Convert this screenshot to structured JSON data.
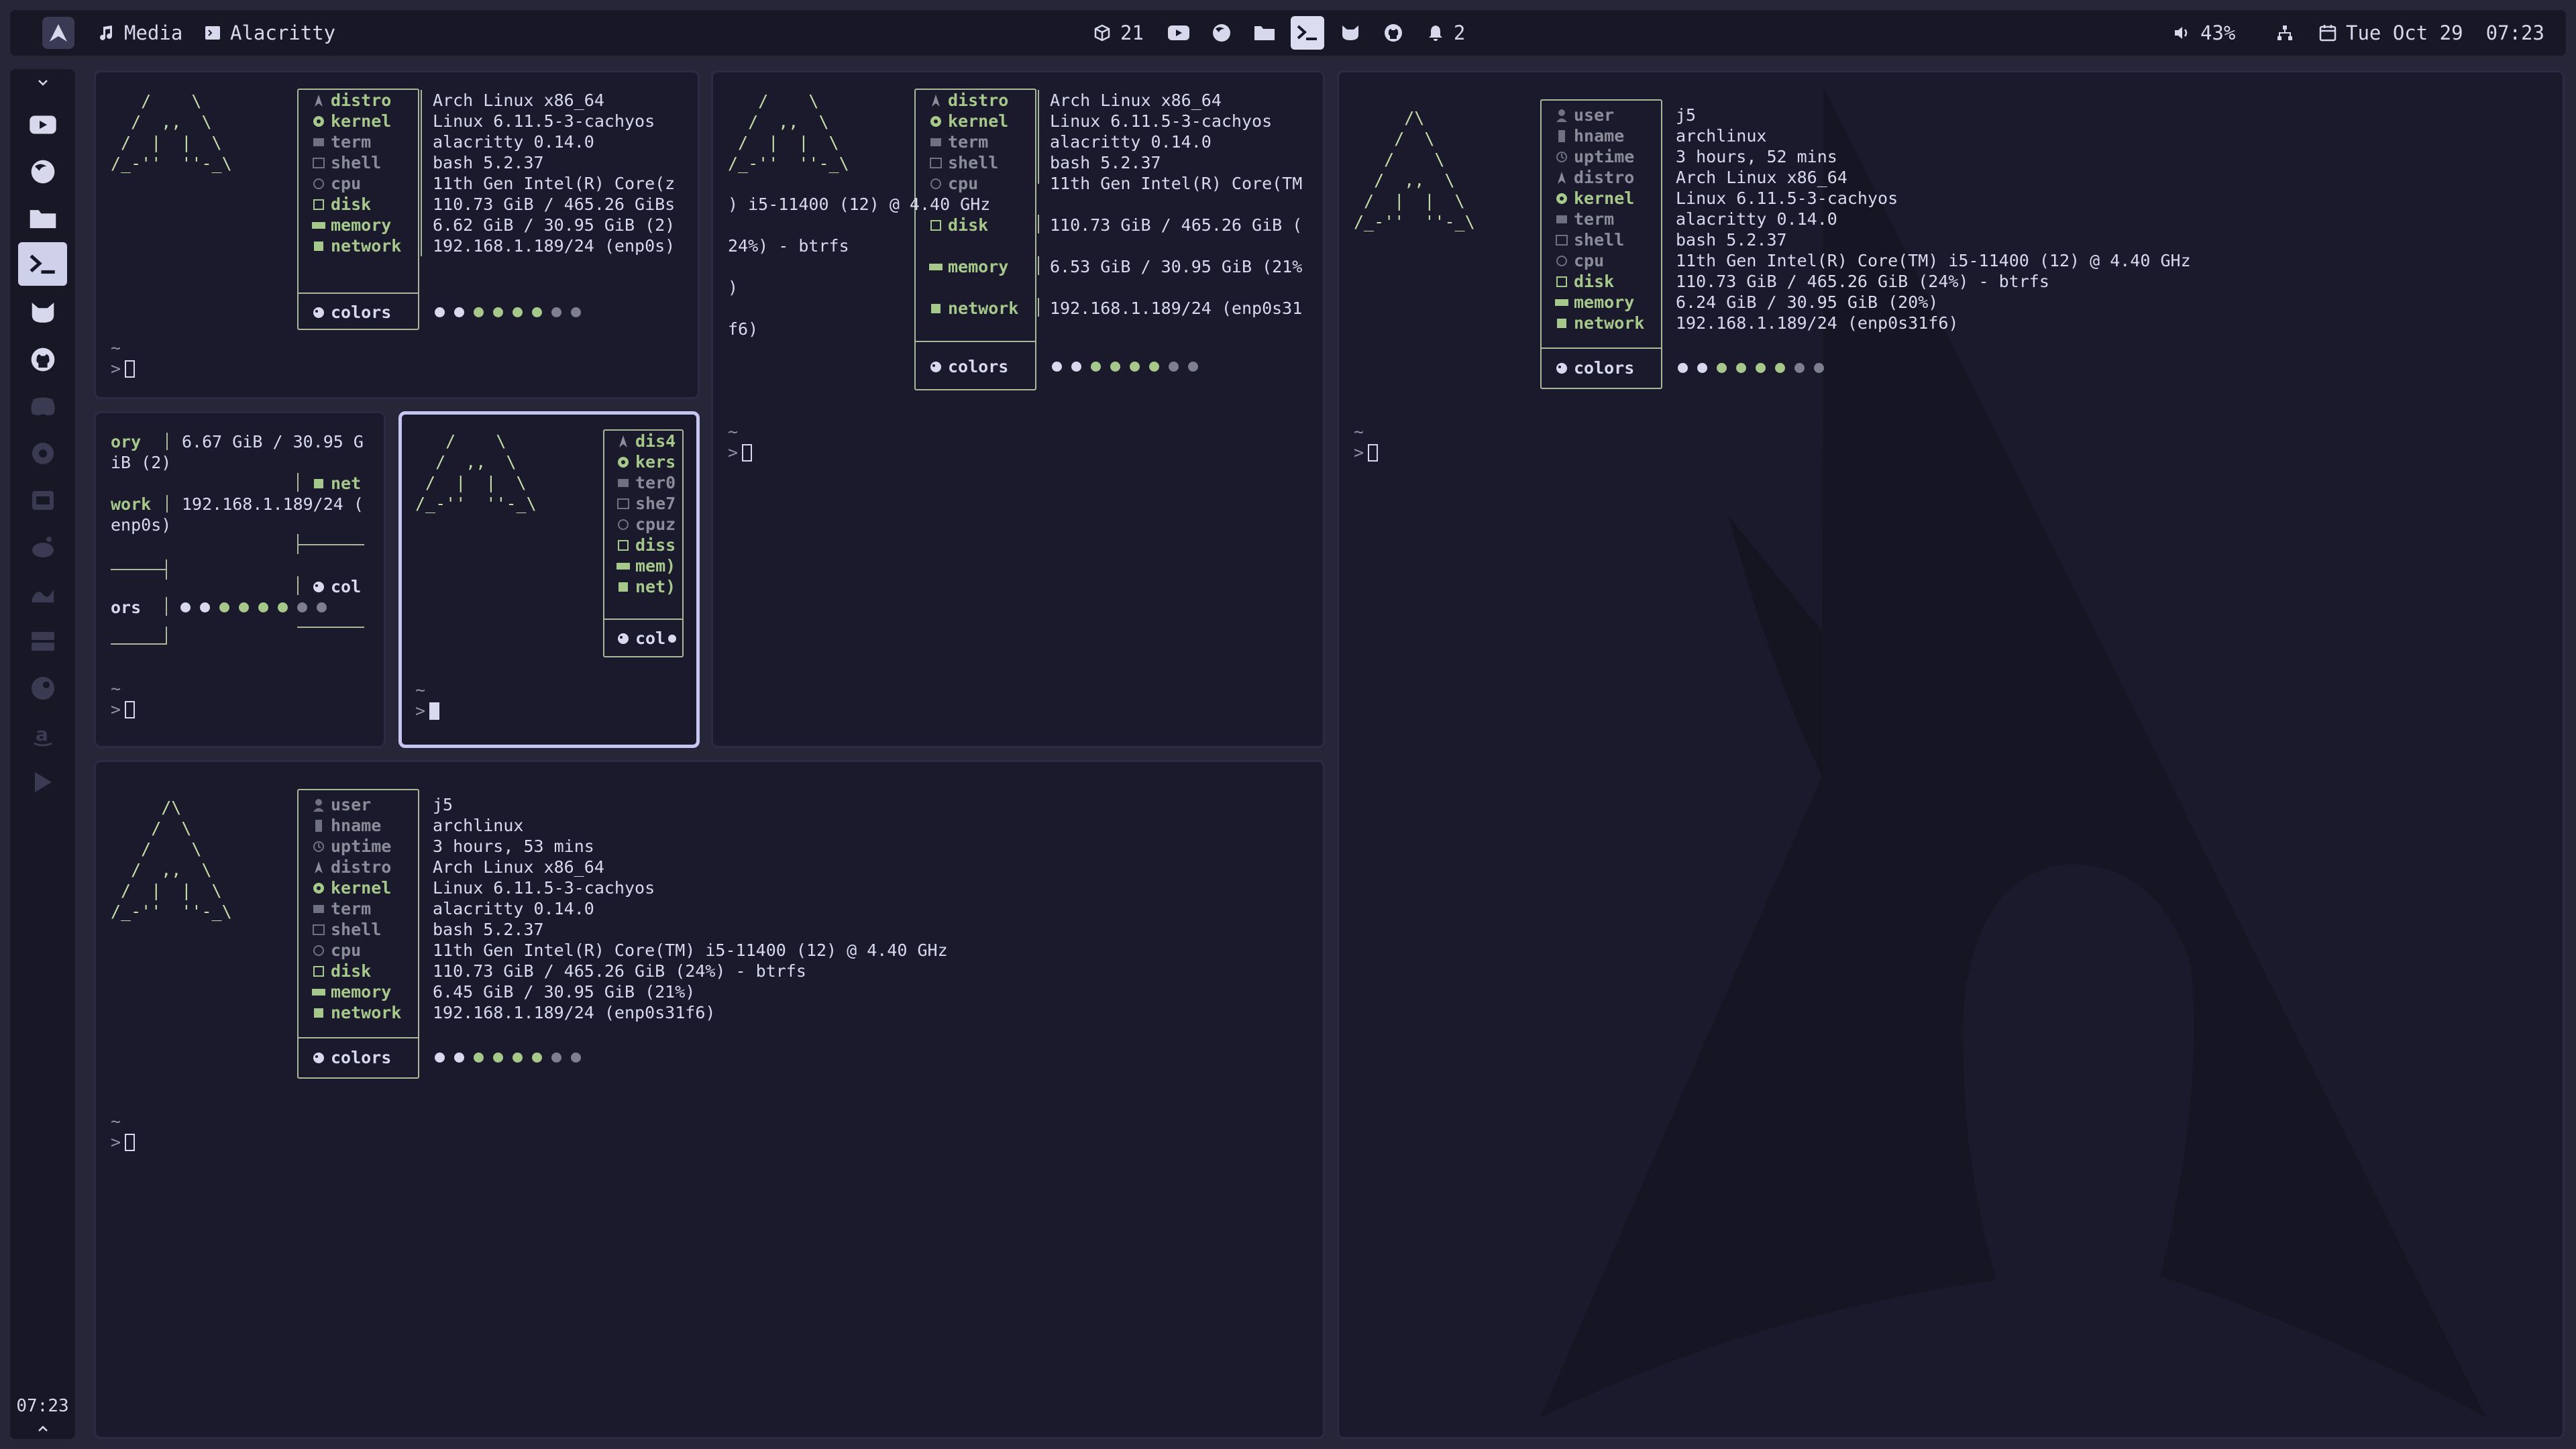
{
  "topbar": {
    "media": "Media",
    "window": "Alacritty",
    "package_count": "21",
    "notifications": "2",
    "volume": "43%",
    "date": "Tue Oct 29",
    "time": "07:23"
  },
  "dock": {
    "clock": "07:23"
  },
  "fetch": {
    "labels": {
      "user": "user",
      "hname": "hname",
      "uptime": "uptime",
      "distro": "distro",
      "kernel": "kernel",
      "term": "term",
      "shell": "shell",
      "cpu": "cpu",
      "disk": "disk",
      "memory": "memory",
      "network": "network",
      "colors": "colors"
    },
    "values": {
      "user": "j5",
      "hname": "archlinux",
      "uptime_a": "3 hours, 52 mins",
      "uptime_b": "3 hours, 53 mins",
      "distro": "Arch Linux x86_64",
      "kernel": "Linux 6.11.5-3-cachyos",
      "term": "alacritty 0.14.0",
      "shell": "bash 5.2.37",
      "cpu": "11th Gen Intel(R) Core(TM) i5-11400 (12) @ 4.40 GHz",
      "disk": "110.73 GiB / 465.26 GiB (24%) - btrfs",
      "memory_right": "6.24 GiB / 30.95 GiB (20%)",
      "memory_bottom": "6.45 GiB / 30.95 GiB (21%)",
      "network": "192.168.1.189/24 (enp0s31f6)"
    },
    "pane1": {
      "cpu": "11th Gen Intel(R) Core(z",
      "disk": "110.73 GiB / 465.26 GiBs",
      "memory": "6.62 GiB / 30.95 GiB (2)",
      "network": "192.168.1.189/24 (enp0s)"
    },
    "pane2": {
      "cpu": "11th Gen Intel(R) Core(TM",
      "wrap1": ") i5-11400 (12) @ 4.40 GHz",
      "disk": "110.73 GiB / 465.26 GiB (",
      "wrap2": "24%) - btrfs",
      "memory": "6.53 GiB / 30.95 GiB (21%",
      "wrap3": ")",
      "network": "192.168.1.189/24 (enp0s31",
      "wrap4": "f6)"
    },
    "pane3": {
      "l1": "ory",
      "v1": "6.67 GiB / 30.95 G",
      "v1b": "iB (2)",
      "lnet": "net",
      "l2": "work",
      "v2": "192.168.1.189/24 (",
      "v2b": "enp0s)",
      "lcol": "col",
      "l3": "ors"
    },
    "pane4": {
      "distro": "dis4",
      "kernel": "kers",
      "term": "ter0",
      "shell": "she7",
      "cpu": "cpuz",
      "disk": "diss",
      "memory": "mem)",
      "network": "net)",
      "colors": "col"
    }
  },
  "prompt": {
    "home": "~",
    "symbol": ">"
  },
  "colors": {
    "accent": "#a6c88a",
    "bg": "#1b1a2c",
    "bar": "#181726"
  }
}
